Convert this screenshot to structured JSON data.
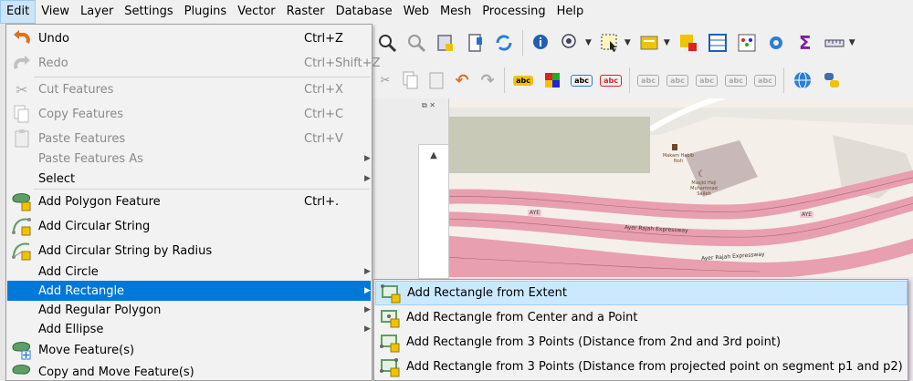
{
  "menubar": {
    "items": [
      "Edit",
      "View",
      "Layer",
      "Settings",
      "Plugins",
      "Vector",
      "Raster",
      "Database",
      "Web",
      "Mesh",
      "Processing",
      "Help"
    ]
  },
  "edit_menu": {
    "items": [
      {
        "label": "Undo",
        "shortcut": "Ctrl+Z",
        "icon": "undo-icon",
        "disabled": false
      },
      {
        "label": "Redo",
        "shortcut": "Ctrl+Shift+Z",
        "icon": "redo-icon",
        "disabled": true
      },
      {
        "label": "Cut Features",
        "shortcut": "Ctrl+X",
        "icon": "scissors-icon",
        "disabled": true
      },
      {
        "label": "Copy Features",
        "shortcut": "Ctrl+C",
        "icon": "copy-icon",
        "disabled": true
      },
      {
        "label": "Paste Features",
        "shortcut": "Ctrl+V",
        "icon": "paste-icon",
        "disabled": true
      },
      {
        "label": "Paste Features As",
        "shortcut": "",
        "disabled": true,
        "submenu": true
      },
      {
        "label": "Select",
        "shortcut": "",
        "disabled": false,
        "submenu": true
      },
      {
        "label": "Add Polygon Feature",
        "shortcut": "Ctrl+.",
        "icon": "add-polygon-icon",
        "disabled": false
      },
      {
        "label": "Add Circular String",
        "shortcut": "",
        "icon": "circular-string-icon",
        "disabled": false
      },
      {
        "label": "Add Circular String by Radius",
        "shortcut": "",
        "icon": "circular-string-radius-icon",
        "disabled": false
      },
      {
        "label": "Add Circle",
        "shortcut": "",
        "disabled": false,
        "submenu": true
      },
      {
        "label": "Add Rectangle",
        "shortcut": "",
        "disabled": false,
        "submenu": true,
        "highlighted": true
      },
      {
        "label": "Add Regular Polygon",
        "shortcut": "",
        "disabled": false,
        "submenu": true
      },
      {
        "label": "Add Ellipse",
        "shortcut": "",
        "disabled": false,
        "submenu": true
      },
      {
        "label": "Move Feature(s)",
        "shortcut": "",
        "icon": "move-feature-icon",
        "disabled": false
      },
      {
        "label": "Copy and Move Feature(s)",
        "shortcut": "",
        "icon": "copy-move-feature-icon",
        "disabled": false
      }
    ]
  },
  "rectangle_submenu": {
    "items": [
      {
        "label": "Add Rectangle from Extent",
        "icon": "rectangle-extent-icon"
      },
      {
        "label": "Add Rectangle from Center and a Point",
        "icon": "rectangle-center-icon"
      },
      {
        "label": "Add Rectangle from 3 Points (Distance from 2nd and 3rd point)",
        "icon": "rectangle-3points-icon"
      },
      {
        "label": "Add Rectangle from 3 Points (Distance from projected point on segment p1 and p2)",
        "icon": "rectangle-3points-projected-icon"
      }
    ]
  },
  "map": {
    "road_labels": [
      "AYE",
      "AYE",
      "Ayer Rajah Expressway",
      "Ayer Rajah Expressway"
    ],
    "poi_labels": [
      "Makam Habib Noh",
      "Masjid Haji Muhammad Salleh"
    ]
  },
  "toolbar": {
    "label_tool_text": "abc"
  },
  "colors": {
    "highlight": "#0078d7",
    "submenu_highlight": "#cce8ff",
    "road": "#e8a0ae",
    "map_background": "#f5efe9"
  }
}
